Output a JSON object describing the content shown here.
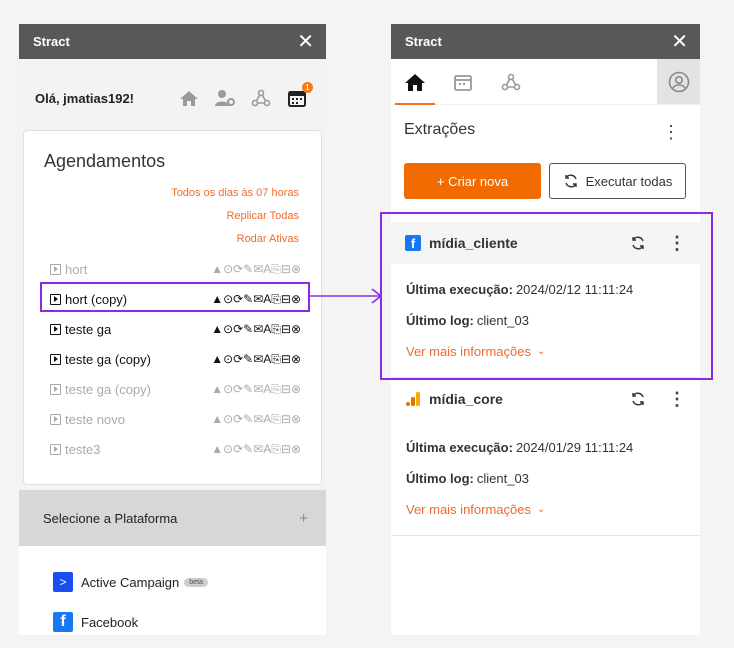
{
  "left": {
    "title": "Stract",
    "close": "✕",
    "greeting": "Olá, jmatias192!",
    "badge_count": "1",
    "section_title": "Agendamentos",
    "links": [
      "Todos os dias às 07 horas",
      "Replicar Todas",
      "Rodar Ativas"
    ],
    "schedules": [
      {
        "name": "hort",
        "state": "off",
        "actions": "▲⊙⟳✎✉A⎘⊟⊗"
      },
      {
        "name": "hort (copy)",
        "state": "on",
        "actions": "▲⊙⟳✎✉A⎘⊟⊗"
      },
      {
        "name": "teste ga",
        "state": "on",
        "actions": "▲⊙⟳✎✉A⎘⊟⊗"
      },
      {
        "name": "teste ga (copy)",
        "state": "on",
        "actions": "▲⊙⟳✎✉A⎘⊟⊗"
      },
      {
        "name": "teste ga (copy)",
        "state": "off",
        "actions": "▲⊙⟳✎✉A⎘⊟⊗"
      },
      {
        "name": "teste novo",
        "state": "off",
        "actions": "▲⊙⟳✎✉A⎘⊟⊗"
      },
      {
        "name": "teste3",
        "state": "off",
        "actions": "▲⊙⟳✎✉A⎘⊟⊗"
      }
    ],
    "platform_header": "Selecione a Plataforma",
    "platform_plus": "+",
    "platforms": [
      {
        "name": "Active Campaign",
        "tag": "beta",
        "color": "#1b4df0",
        "icon": ">"
      },
      {
        "name": "Facebook",
        "tag": "",
        "color": "#1877f2",
        "icon": "f"
      }
    ]
  },
  "right": {
    "title": "Stract",
    "close": "✕",
    "section_title": "Extrações",
    "create_button": "+  Criar nova",
    "run_all_button": "Executar todas",
    "extractions": [
      {
        "name": "mídia_cliente",
        "platform": "facebook",
        "last_run_label": "Última execução:",
        "last_run": "2024/02/12 11:11:24",
        "last_log_label": "Último log:",
        "last_log": "client_03",
        "more": "Ver mais informações"
      },
      {
        "name": "mídia_core",
        "platform": "google-analytics",
        "last_run_label": "Última execução:",
        "last_run": "2024/01/29 11:11:24",
        "last_log_label": "Último log:",
        "last_log": "client_03",
        "more": "Ver mais informações"
      }
    ]
  },
  "colors": {
    "accent": "#f26b00",
    "header": "#585858",
    "highlight": "#8a2be2"
  }
}
